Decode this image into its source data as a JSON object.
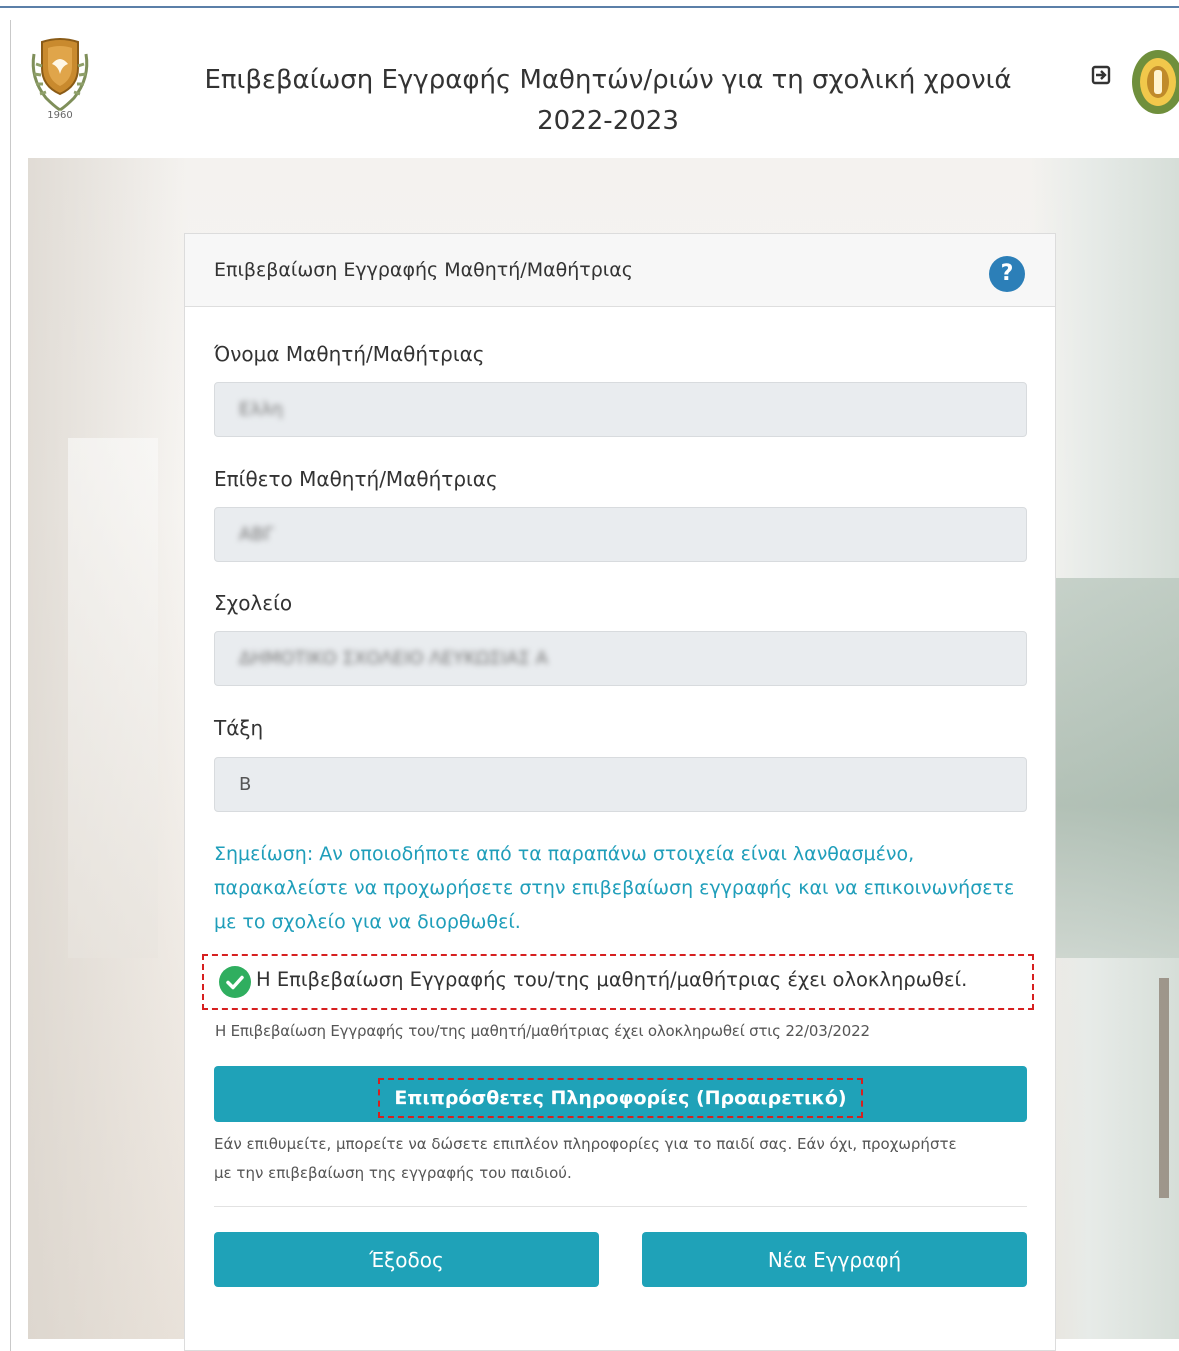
{
  "header": {
    "title": "Επιβεβαίωση Εγγραφής Μαθητών/ριών για τη σχολική χρονιά 2022-2023"
  },
  "panel": {
    "title": "Επιβεβαίωση Εγγραφής Μαθητή/Μαθήτριας",
    "fields": [
      {
        "label": "Όνομα Μαθητή/Μαθήτριας",
        "value": "Ελλη"
      },
      {
        "label": "Επίθετο Μαθητή/Μαθήτριας",
        "value": "ΑΒΓ"
      },
      {
        "label": "Σχολείο",
        "value": "ΔΗΜΟΤΙΚΟ ΣΧΟΛΕΙΟ ΛΕΥΚΩΣΙΑΣ Α"
      },
      {
        "label": "Τάξη",
        "value": "B"
      }
    ],
    "note": "Σημείωση: Αν οποιοδήποτε από τα παραπάνω στοιχεία είναι λανθασμένο, παρακαλείστε να προχωρήσετε στην επιβεβαίωση εγγραφής και να επικοινωνήσετε με το σχολείο για να διορθωθεί.",
    "status": {
      "message": "Η Επιβεβαίωση Εγγραφής του/της μαθητή/μαθήτριας έχει ολοκληρωθεί.",
      "date_line": "Η Επιβεβαίωση Εγγραφής του/της μαθητή/μαθήτριας έχει ολοκληρωθεί στις 22/03/2022"
    },
    "info_button": "Επιπρόσθετες Πληροφορίες (Προαιρετικό)",
    "info_note": "Εάν επιθυμείτε, μπορείτε να δώσετε επιπλέον πληροφορίες για το παιδί σας. Εάν όχι, προχωρήστε με την επιβεβαίωση της εγγραφής του παιδιού.",
    "exit_button": "Έξοδος",
    "new_button": "Νέα Εγγραφή"
  },
  "icons": {
    "logo_left": "cyprus-emblem-icon",
    "logo_right": "ministry-emblem-icon",
    "exit": "logout-icon",
    "help": "help-icon",
    "status": "check-circle-icon"
  },
  "colors": {
    "accent": "#1fa2b8",
    "note": "#1f9eba",
    "success": "#2fae5f",
    "help": "#2c7fb8",
    "highlight": "#d62020"
  }
}
